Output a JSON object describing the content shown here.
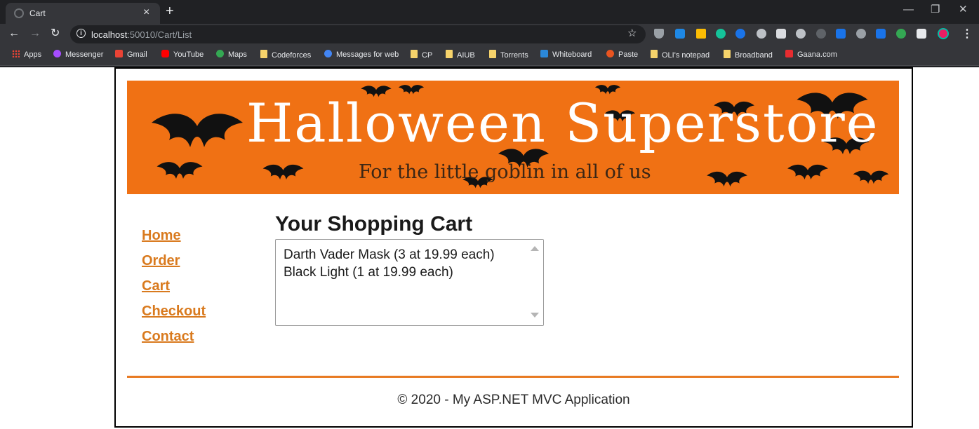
{
  "browser": {
    "tab_title": "Cart",
    "tab_close": "×",
    "new_tab": "+",
    "address_host": "localhost",
    "address_path": ":50010/Cart/List",
    "bookmarks": [
      {
        "label": "Apps",
        "icon": "apps-grid-icon",
        "color": "#ea4335"
      },
      {
        "label": "Messenger",
        "icon": "messenger-icon",
        "color": "#a64dff"
      },
      {
        "label": "Gmail",
        "icon": "gmail-icon",
        "color": "#ea4335"
      },
      {
        "label": "YouTube",
        "icon": "youtube-icon",
        "color": "#ff0000"
      },
      {
        "label": "Maps",
        "icon": "maps-icon",
        "color": "#34a853"
      },
      {
        "label": "Codeforces",
        "icon": "folder-icon",
        "color": "#f6d36b"
      },
      {
        "label": "Messages for web",
        "icon": "messages-icon",
        "color": "#4285f4"
      },
      {
        "label": "CP",
        "icon": "folder-icon",
        "color": "#f6d36b"
      },
      {
        "label": "AIUB",
        "icon": "folder-icon",
        "color": "#f6d36b"
      },
      {
        "label": "Torrents",
        "icon": "folder-icon",
        "color": "#f6d36b"
      },
      {
        "label": "Whiteboard",
        "icon": "whiteboard-icon",
        "color": "#2b88d8"
      },
      {
        "label": "Paste",
        "icon": "ubuntu-icon",
        "color": "#e95420"
      },
      {
        "label": "OLI's notepad",
        "icon": "folder-icon",
        "color": "#f6d36b"
      },
      {
        "label": "Broadband",
        "icon": "folder-icon",
        "color": "#f6d36b"
      },
      {
        "label": "Gaana.com",
        "icon": "gaana-icon",
        "color": "#e72c30"
      }
    ]
  },
  "site": {
    "banner_title": "Halloween Superstore",
    "banner_tagline": "For the little goblin in all of us",
    "accent_color": "#f07114",
    "nav": [
      "Home",
      "Order",
      "Cart",
      "Checkout",
      "Contact"
    ],
    "cart_heading": "Your Shopping Cart",
    "cart_items": [
      "Darth Vader Mask (3 at 19.99 each)",
      "Black Light (1 at 19.99 each)"
    ],
    "footer": "© 2020 - My ASP.NET MVC Application"
  }
}
